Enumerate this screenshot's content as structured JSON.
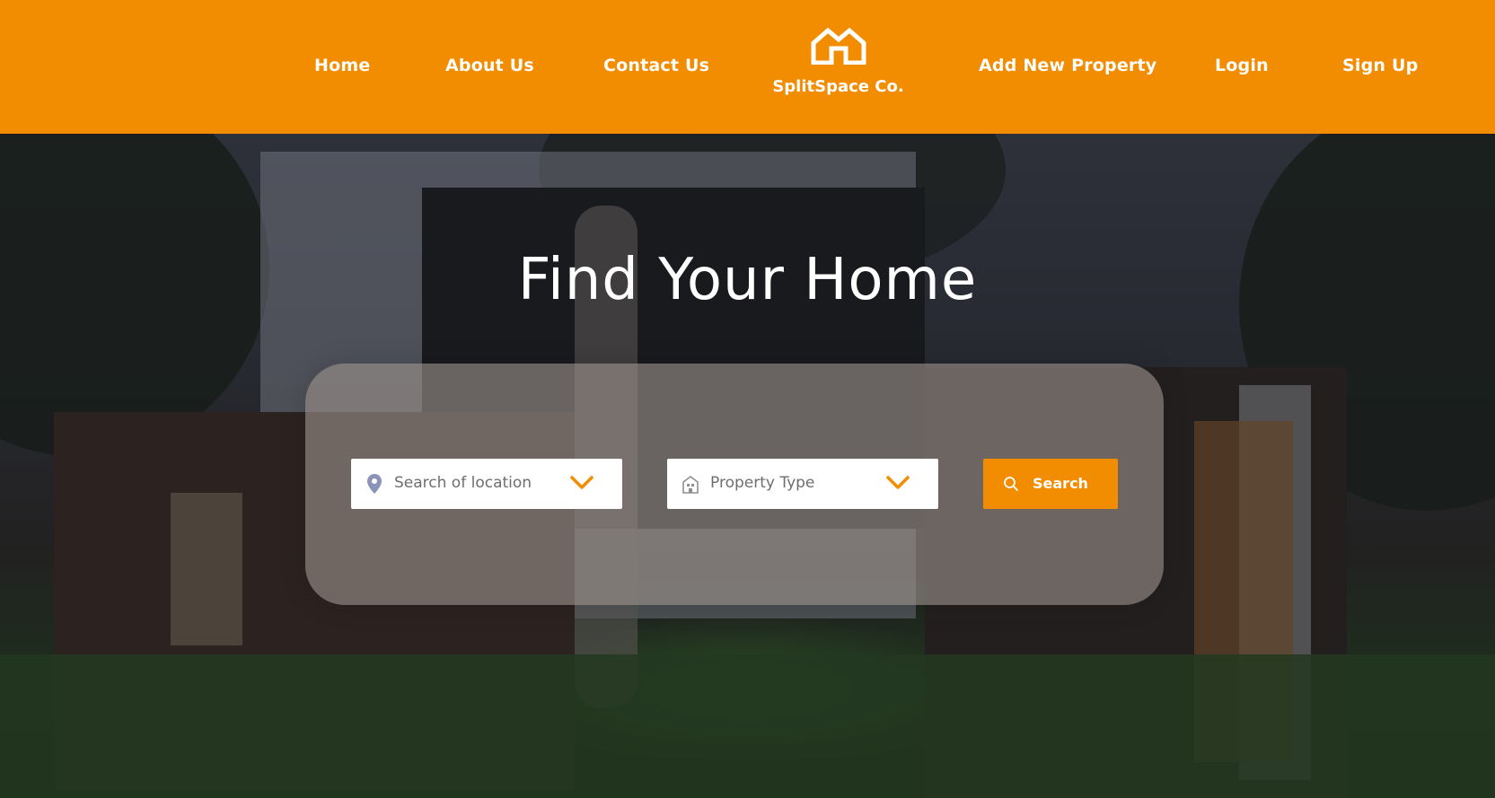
{
  "header": {
    "nav_left": [
      {
        "label": "Home"
      },
      {
        "label": "About Us"
      },
      {
        "label": "Contact Us"
      }
    ],
    "logo": {
      "text": "SplitSpace Co.",
      "icon": "house-outline-icon"
    },
    "nav_right": [
      {
        "label": "Add New Property"
      },
      {
        "label": "Login"
      },
      {
        "label": "Sign Up"
      }
    ],
    "background_color": "#f28c00"
  },
  "hero": {
    "title": "Find Your Home",
    "search": {
      "location": {
        "placeholder": "Search of location",
        "icon": "map-pin-icon"
      },
      "property_type": {
        "placeholder": "Property Type",
        "icon": "building-icon"
      },
      "button": {
        "label": "Search",
        "icon": "search-icon"
      }
    }
  },
  "colors": {
    "accent": "#f28c00",
    "text_light": "#ffffff",
    "placeholder": "#6e6e6e"
  }
}
